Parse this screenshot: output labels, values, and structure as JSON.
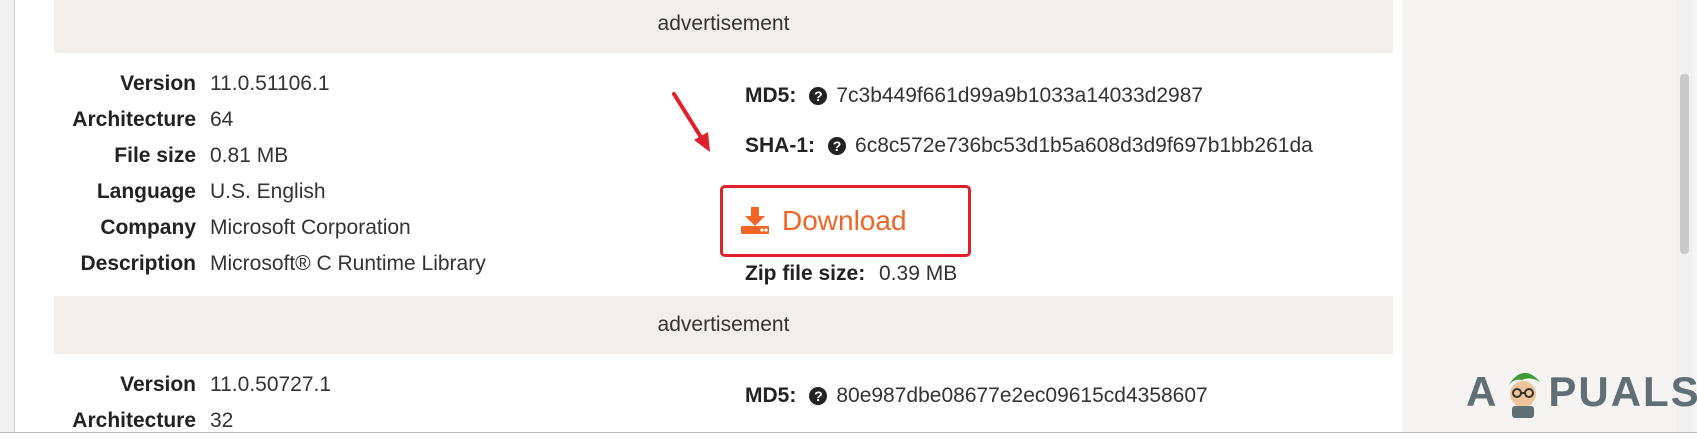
{
  "ads": {
    "label": "advertisement"
  },
  "entry1": {
    "details": [
      {
        "label": "Version",
        "value": "11.0.51106.1"
      },
      {
        "label": "Architecture",
        "value": "64"
      },
      {
        "label": "File size",
        "value": "0.81 MB"
      },
      {
        "label": "Language",
        "value": "U.S. English"
      },
      {
        "label": "Company",
        "value": "Microsoft Corporation"
      },
      {
        "label": "Description",
        "value": "Microsoft® C Runtime Library"
      }
    ],
    "md5_label": "MD5:",
    "md5": "7c3b449f661d99a9b1033a14033d2987",
    "sha1_label": "SHA-1:",
    "sha1": "6c8c572e736bc53d1b5a608d3d9f697b1bb261da",
    "download_label": "Download",
    "zip_label": "Zip file size:",
    "zip_value": "0.39 MB"
  },
  "entry2": {
    "details": [
      {
        "label": "Version",
        "value": "11.0.50727.1"
      },
      {
        "label": "Architecture",
        "value": "32"
      }
    ],
    "md5_label": "MD5:",
    "md5": "80e987dbe08677e2ec09615cd4358607"
  },
  "watermark": {
    "left": "A",
    "right": "PUALS"
  },
  "colors": {
    "accent": "#f06523",
    "highlight": "#e0202a",
    "band": "#f1eeeb"
  }
}
